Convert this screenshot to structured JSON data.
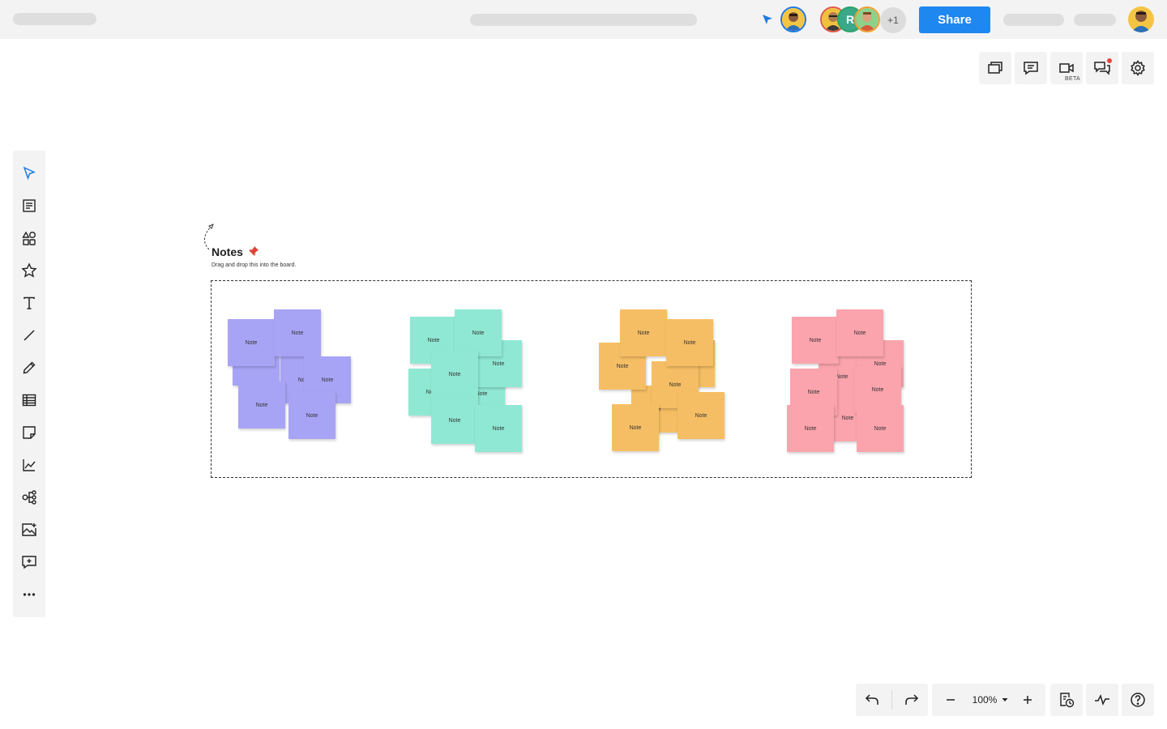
{
  "topbar": {
    "share_label": "Share",
    "extra_collaborators": "+1",
    "collaborator_letter": "R"
  },
  "right_toolbar": {
    "video_badge": "BETA"
  },
  "canvas": {
    "title": "Notes",
    "subtitle": "Drag and drop this into the board."
  },
  "note_label": "Note",
  "note_colors": {
    "purple": "#a8a4f5",
    "teal": "#8fe8d4",
    "orange": "#f6be64",
    "pink": "#fba4ad"
  },
  "accent": "#1f87f0",
  "zoom": {
    "level": "100%"
  },
  "icons": {
    "left_toolbar": [
      "select-icon",
      "template-icon",
      "shapes-icon",
      "favorite-icon",
      "text-icon",
      "line-icon",
      "pen-icon",
      "table-icon",
      "sticky-note-icon",
      "chart-icon",
      "mindmap-icon",
      "image-icon",
      "comment-add-icon",
      "more-icon"
    ],
    "right_toolbar": [
      "pages-icon",
      "comments-icon",
      "video-icon",
      "chat-icon",
      "settings-icon"
    ],
    "bottom_toolbar": [
      "undo-icon",
      "redo-icon",
      "zoom-out-icon",
      "zoom-in-icon",
      "history-icon",
      "activity-icon",
      "help-icon"
    ]
  }
}
